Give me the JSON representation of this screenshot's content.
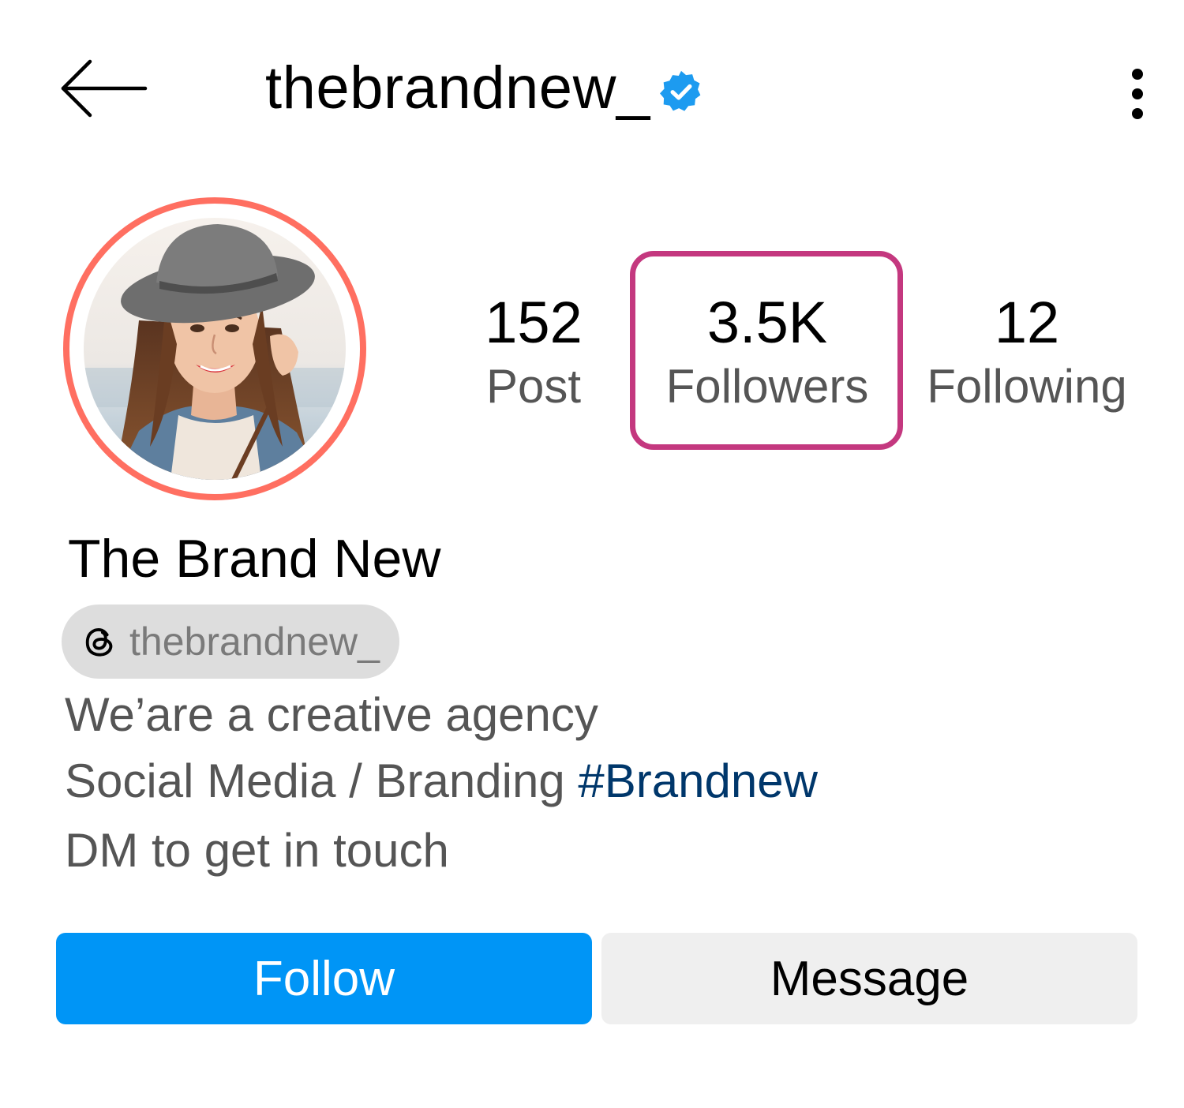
{
  "header": {
    "username": "thebrandnew_",
    "back_icon": "arrow-left-icon",
    "verified_icon": "verified-badge-icon",
    "more_icon": "more-vertical-icon"
  },
  "profile": {
    "avatar": "profile-photo",
    "display_name": "The Brand New",
    "threads_handle": "thebrandnew_",
    "threads_icon": "threads-icon"
  },
  "stats": [
    {
      "value": "152",
      "label": "Post"
    },
    {
      "value": "3.5K",
      "label": "Followers"
    },
    {
      "value": "12",
      "label": "Following"
    }
  ],
  "bio": {
    "line1": "We’are a creative agency",
    "line2_text": "Social Media / Branding ",
    "line2_hashtag": "#Brandnew",
    "line3": "DM to get in touch"
  },
  "actions": {
    "follow_label": "Follow",
    "message_label": "Message"
  },
  "colors": {
    "follow_button": "#0095f6",
    "message_button": "#efefef",
    "avatar_ring": "#ff6f61",
    "highlight_box": "#c4387f",
    "verified_badge": "#1d9bf0",
    "hashtag": "#00376b"
  }
}
